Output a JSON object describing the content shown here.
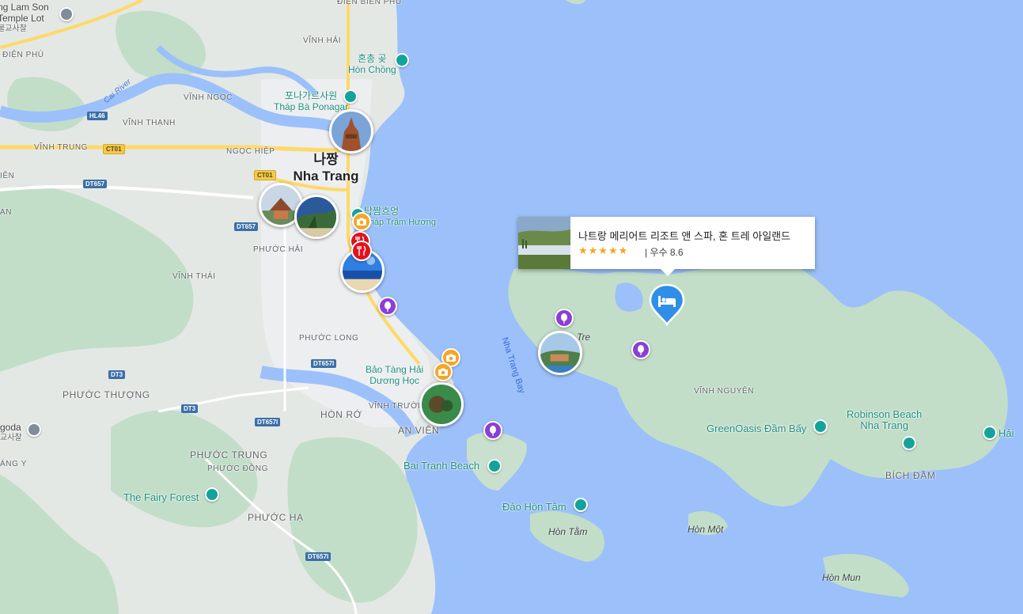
{
  "map": {
    "colors": {
      "water": "#9cc0f9",
      "land": "#dfe6e1",
      "urban": "#eaebed",
      "forest": "#bfdcc8",
      "road_major": "#ffd966",
      "road": "#ffffff"
    },
    "cities": [
      {
        "id": "nhatrang",
        "ko": "나짱",
        "name": "Nha Trang"
      }
    ],
    "districts": [
      {
        "id": "dienbienphu",
        "text": "ĐIỆN BIÊN PHỦ"
      },
      {
        "id": "vinhhai",
        "text": "VĨNH HẢI"
      },
      {
        "id": "dienphu",
        "text": "ĐIỆN PHÚ"
      },
      {
        "id": "vinhngoc",
        "text": "VĨNH NGỌC"
      },
      {
        "id": "vinhthanh",
        "text": "VĨNH THẠNH"
      },
      {
        "id": "vinhtrung",
        "text": "VĨNH TRUNG"
      },
      {
        "id": "ngochiep",
        "text": "NGỌC HIỆP"
      },
      {
        "id": "phuochai",
        "text": "PHƯỚC HẢI"
      },
      {
        "id": "vinhthai",
        "text": "VĨNH THÁI"
      },
      {
        "id": "phuoclong",
        "text": "PHƯỚC LONG"
      },
      {
        "id": "phuocthuong",
        "text": "PHƯỚC THƯỢNG"
      },
      {
        "id": "honro",
        "text": "HÒN RỚ"
      },
      {
        "id": "vinhtruong",
        "text": "VĨNH TRƯỜN"
      },
      {
        "id": "anvien",
        "text": "AN VIÊN"
      },
      {
        "id": "phuoctrung",
        "text": "PHƯỚC TRUNG"
      },
      {
        "id": "phuocdong",
        "text": "PHƯỚC ĐỒNG"
      },
      {
        "id": "phuocha",
        "text": "PHƯỚC HẠ"
      },
      {
        "id": "vinhnguyen",
        "text": "VĨNH NGUYÊN"
      },
      {
        "id": "bichdam",
        "text": "BÍCH ĐẦM"
      },
      {
        "id": "ien",
        "text": "IÊN"
      },
      {
        "id": "an",
        "text": "AN"
      },
      {
        "id": "angy",
        "text": "ÁNG Y"
      }
    ],
    "pois": [
      {
        "id": "lamson",
        "line1": "ng Lam Son",
        "line2": "Temple Lot",
        "line3": "불교사찰"
      },
      {
        "id": "honchong",
        "line1": "혼총 곶",
        "line2": "Hòn Chồng"
      },
      {
        "id": "ponagar",
        "line1": "포나가르사원",
        "line2": "Tháp Bà Ponagar"
      },
      {
        "id": "tramhuong",
        "line1": "탑짬흐엉",
        "line2": "Tháp Trầm Hương"
      },
      {
        "id": "baotang",
        "line1": "Bảo Tàng Hải",
        "line2": "Dương Học"
      },
      {
        "id": "baitranh",
        "line1": "Bai Tranh Beach"
      },
      {
        "id": "honotam",
        "line1": "Đảo Hòn Tằm"
      },
      {
        "id": "greenoasis",
        "line1": "GreenOasis Đầm Bấy"
      },
      {
        "id": "robinson",
        "line1": "Robinson Beach",
        "line2": "Nha Trang"
      },
      {
        "id": "hai",
        "line1": "Hải"
      },
      {
        "id": "fairy",
        "line1": "The Fairy Forest"
      },
      {
        "id": "pagoda",
        "line1": "goda",
        "line2": "교사찰"
      }
    ],
    "islands": [
      {
        "id": "hontam",
        "text": "Hòn Tằm"
      },
      {
        "id": "honmot",
        "text": "Hòn Một"
      },
      {
        "id": "honmun",
        "text": "Hòn Mun"
      },
      {
        "id": "tre",
        "text": "Tre"
      }
    ],
    "water_labels": {
      "bay": "Nha Trang Bay",
      "river": "Cai River"
    },
    "shields": [
      {
        "id": "hl46",
        "text": "HL46",
        "style": "blue"
      },
      {
        "id": "ct01a",
        "text": "CT01",
        "style": "yellow"
      },
      {
        "id": "ct01b",
        "text": "CT01",
        "style": "yellow"
      },
      {
        "id": "dt657a",
        "text": "DT657",
        "style": "blue"
      },
      {
        "id": "dt657b",
        "text": "DT657",
        "style": "blue"
      },
      {
        "id": "dt657i",
        "text": "DT657I",
        "style": "blue"
      },
      {
        "id": "dt3a",
        "text": "DT3",
        "style": "blue"
      },
      {
        "id": "dt3b",
        "text": "DT3",
        "style": "blue"
      },
      {
        "id": "dt657ib",
        "text": "DT657I",
        "style": "blue"
      },
      {
        "id": "dt657ic",
        "text": "DT657I",
        "style": "blue"
      }
    ]
  },
  "popup": {
    "title": "나트랑 메리어트 리조트 앤 스파, 혼 트레 아일랜드",
    "stars": "★★★★★",
    "rating": "| 우수 8.6"
  },
  "markers": {
    "hotel_icon": "bed-icon",
    "attraction_icon": "camera-icon",
    "activity_icon": "balloon-icon"
  }
}
